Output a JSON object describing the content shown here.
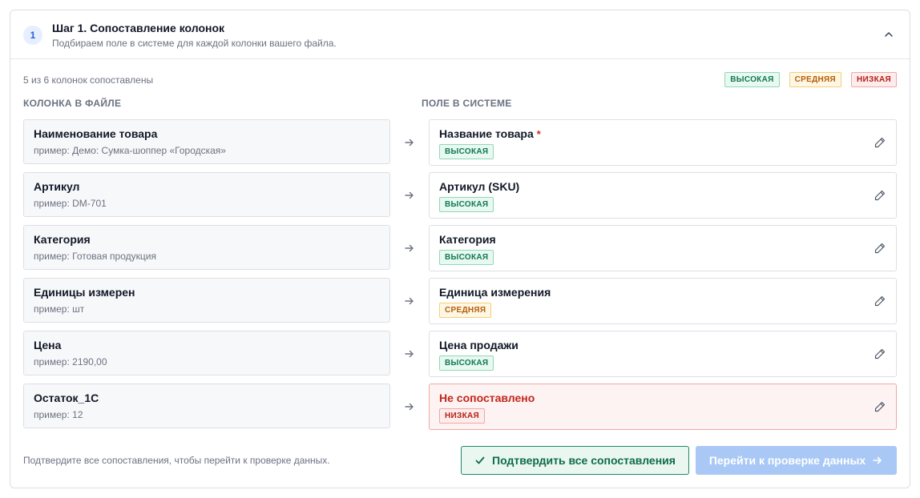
{
  "header": {
    "step_number": "1",
    "title": "Шаг 1. Сопоставление колонок",
    "subtitle": "Подбираем поле в системе для каждой колонки вашего файла."
  },
  "summary": "5 из 6 колонок сопоставлены",
  "legend": {
    "high": "ВЫСОКАЯ",
    "mid": "СРЕДНЯЯ",
    "low": "НИЗКАЯ"
  },
  "columns": {
    "file": "КОЛОНКА В ФАЙЛЕ",
    "system": "ПОЛЕ В СИСТЕМЕ"
  },
  "rows": [
    {
      "src_name": "Наименование товара",
      "src_example": "пример: Демо: Сумка-шоппер «Городская»",
      "dst_name": "Название товара",
      "required_mark": "*",
      "confidence": "ВЫСОКАЯ"
    },
    {
      "src_name": "Артикул",
      "src_example": "пример: DM-701",
      "dst_name": "Артикул (SKU)",
      "confidence": "ВЫСОКАЯ"
    },
    {
      "src_name": "Категория",
      "src_example": "пример: Готовая продукция",
      "dst_name": "Категория",
      "confidence": "ВЫСОКАЯ"
    },
    {
      "src_name": "Единицы измерен",
      "src_example": "пример: шт",
      "dst_name": "Единица измерения",
      "confidence": "СРЕДНЯЯ"
    },
    {
      "src_name": "Цена",
      "src_example": "пример: 2190,00",
      "dst_name": "Цена продажи",
      "confidence": "ВЫСОКАЯ"
    },
    {
      "src_name": "Остаток_1С",
      "src_example": "пример: 12",
      "dst_name": "Не сопоставлено",
      "confidence": "НИЗКАЯ"
    }
  ],
  "footer": {
    "note": "Подтвердите все сопоставления, чтобы перейти к проверке данных.",
    "confirm_label": "Подтвердить все сопоставления",
    "next_label": "Перейти к проверке данных"
  },
  "icons": {
    "collapse": "chevron-up-icon",
    "arrow": "arrow-right-icon",
    "edit": "pencil-icon",
    "confirm": "check-icon",
    "next": "arrow-right-icon"
  },
  "colors": {
    "accent": "#2b5fd9",
    "high": "#0f7a55",
    "mid": "#b45f06",
    "low": "#b42318",
    "next_button_disabled": "#a9c8f6"
  }
}
